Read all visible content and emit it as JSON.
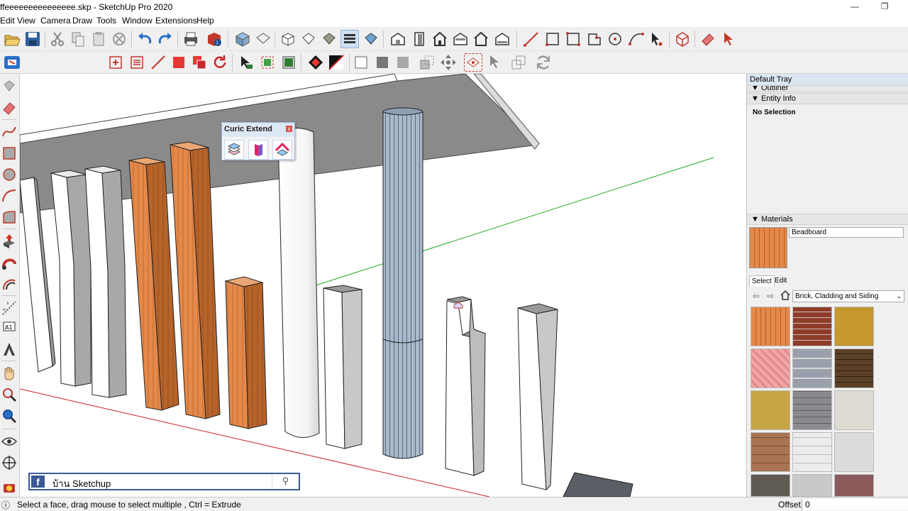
{
  "window": {
    "title": "ffeeeeeeeeeeeeeee.skp - SketchUp Pro 2020",
    "minimize": "—",
    "maximize": "❐"
  },
  "menu": [
    "Edit",
    "View",
    "Camera",
    "Draw",
    "Tools",
    "Window",
    "Extensions",
    "Help"
  ],
  "tray": {
    "title": "Default Tray",
    "sections": {
      "outliner": "▼ Outliner",
      "entity_info": "▼ Entity Info",
      "materials": "▼ Materials"
    },
    "entity_info_text": "No Selection",
    "material_name": "Beadboard",
    "tabs": {
      "select": "Select",
      "edit": "Edit"
    },
    "library": "Brick, Cladding and Siding"
  },
  "curic": {
    "title": "Curic Extend",
    "close": "x"
  },
  "facebook": {
    "logo": "f",
    "page_name": "บ้าน Sketchup",
    "search_glyph": "⚲"
  },
  "status": {
    "message": "Select a face, drag mouse to select multiple , Ctrl = Extrude",
    "vcb_label": "Offset",
    "vcb_value": "0"
  },
  "colors": {
    "wood": "#e5894a",
    "sky_blue_column": "#a9b9cc",
    "tray_header": "#dbe6f3",
    "facebook_blue": "#3b5998",
    "green_axis": "#22aa22",
    "red_axis": "#cc2222"
  },
  "toolbar_icons": [
    "open-icon",
    "save-icon",
    "cut-icon",
    "copy-icon",
    "paste-icon",
    "erase-icon",
    "undo-icon",
    "redo-icon",
    "print-icon",
    "model-info-icon",
    "iso-view-icon",
    "top-view-icon",
    "front-view-icon",
    "right-view-icon",
    "back-view-icon",
    "left-view-icon",
    "xray-icon",
    "wireframe-icon",
    "hidden-line-icon",
    "shaded-icon",
    "textured-icon",
    "monochrome-icon",
    "line-icon",
    "rectangle-icon",
    "circle-icon",
    "arc-icon",
    "select-icon",
    "eraser-icon"
  ],
  "materials_swatches": [
    "wood-vertical",
    "brick-red",
    "stone-yellow",
    "tile-pink",
    "stone-blue",
    "brick-dark",
    "stone-ochre",
    "brick-grey",
    "stone-beige",
    "siding-brown",
    "siding-white",
    "stucco-grey",
    "stone-dark",
    "siding-light",
    "brick-mixed"
  ]
}
